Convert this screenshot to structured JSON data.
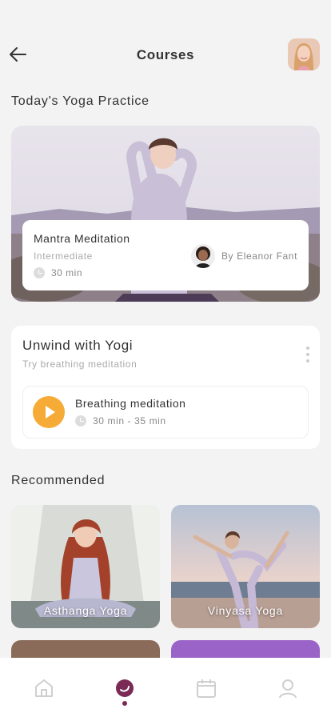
{
  "header": {
    "title": "Courses",
    "back_icon": "arrow-left-icon"
  },
  "today": {
    "section_title": "Today's Yoga Practice",
    "course_name": "Mantra Meditation",
    "level": "Intermediate",
    "duration": "30 min",
    "author": "By Eleanor Fant"
  },
  "unwind": {
    "title": "Unwind with Yogi",
    "subtitle": "Try breathing meditation",
    "session_title": "Breathing meditation",
    "session_duration": "30 min - 35 min"
  },
  "recommended": {
    "section_title": "Recommended",
    "items": [
      {
        "label": "Asthanga Yoga"
      },
      {
        "label": "Vinyasa Yoga"
      }
    ]
  },
  "tabbar": {
    "items": [
      {
        "icon": "home-icon"
      },
      {
        "icon": "meditation-icon",
        "active": true
      },
      {
        "icon": "calendar-icon"
      },
      {
        "icon": "profile-icon"
      }
    ],
    "active_color": "#7a2a55",
    "inactive_color": "#cfcfcf"
  },
  "colors": {
    "accent": "#f5ab35",
    "background": "#f3f3f3"
  }
}
